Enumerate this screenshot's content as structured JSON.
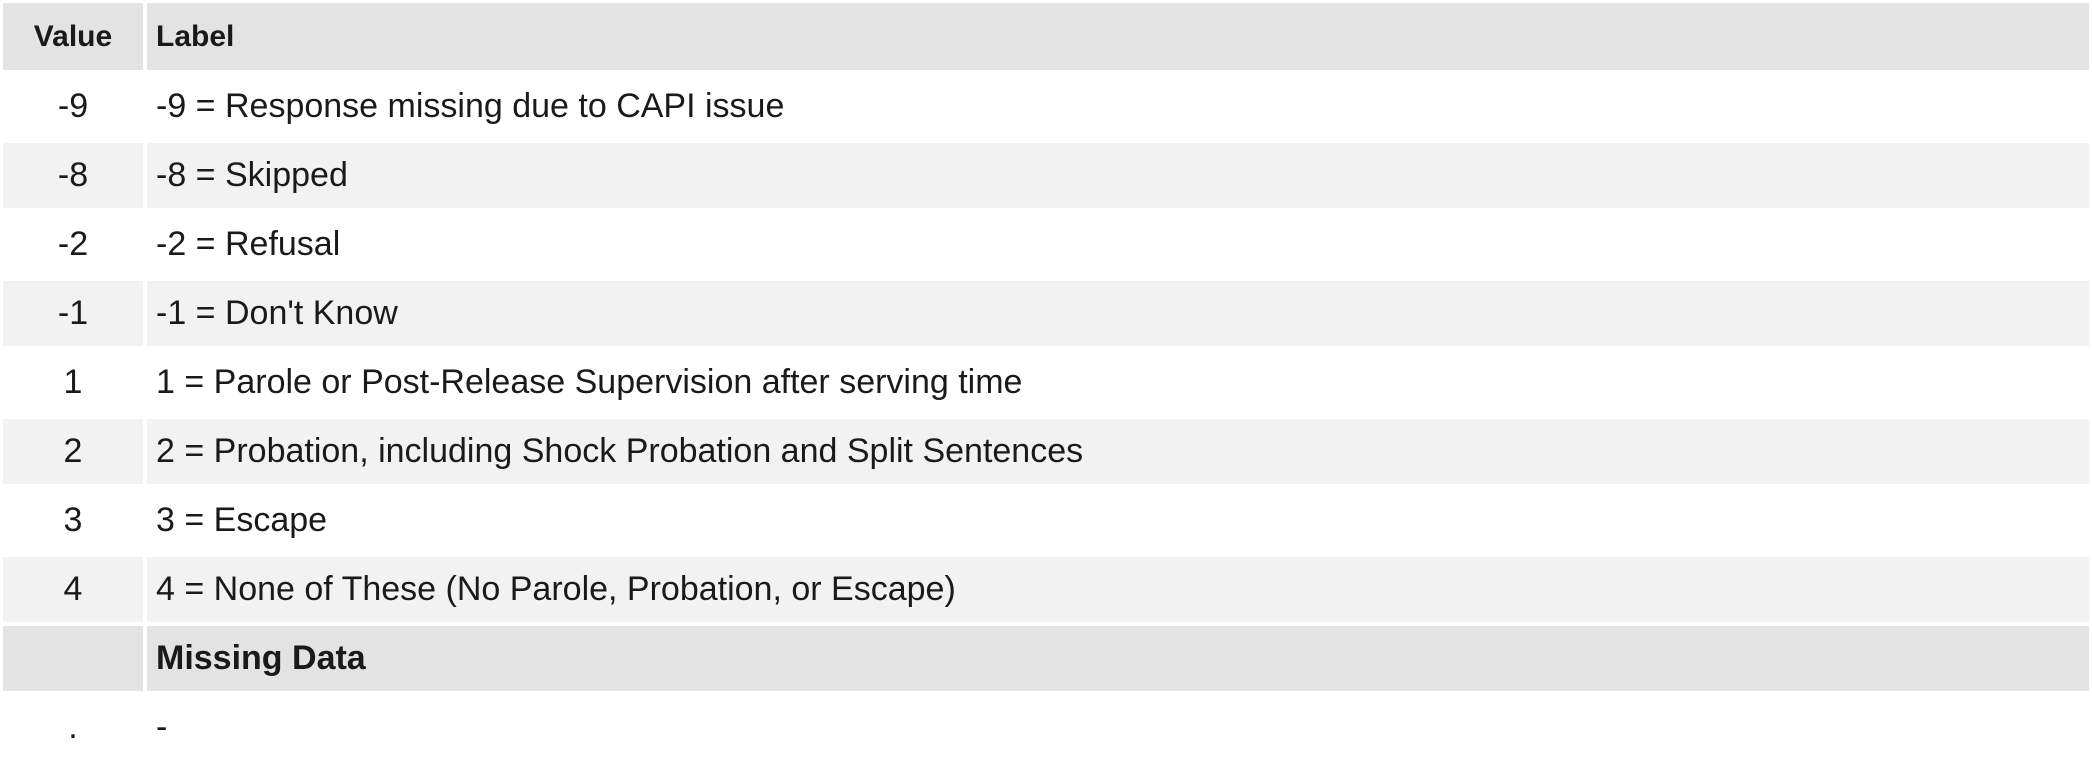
{
  "table": {
    "headers": {
      "value": "Value",
      "label": "Label"
    },
    "rows": [
      {
        "value": "-9",
        "label": "-9 = Response missing due to CAPI issue"
      },
      {
        "value": "-8",
        "label": "-8 = Skipped"
      },
      {
        "value": "-2",
        "label": "-2 = Refusal"
      },
      {
        "value": "-1",
        "label": "-1 = Don't Know"
      },
      {
        "value": "1",
        "label": "1 = Parole or Post-Release Supervision after serving time"
      },
      {
        "value": "2",
        "label": "2 = Probation, including Shock Probation and Split Sentences"
      },
      {
        "value": "3",
        "label": "3 = Escape"
      },
      {
        "value": "4",
        "label": "4 = None of These (No Parole, Probation, or Escape)"
      }
    ],
    "missing_section": {
      "title": "Missing Data",
      "rows": [
        {
          "value": ".",
          "label": "-"
        }
      ]
    }
  }
}
